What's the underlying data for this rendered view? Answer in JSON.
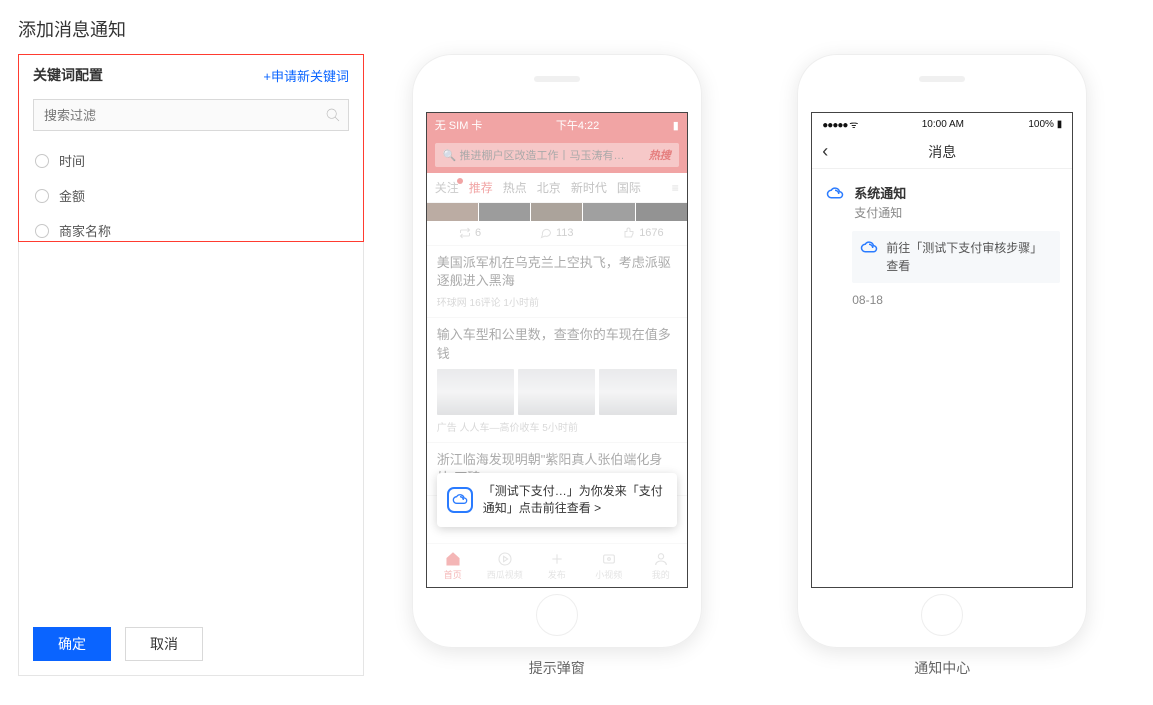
{
  "page": {
    "title": "添加消息通知"
  },
  "config": {
    "title": "关键词配置",
    "apply_link": "+申请新关键词",
    "search_placeholder": "搜索过滤",
    "options": [
      "时间",
      "金额",
      "商家名称"
    ],
    "confirm": "确定",
    "cancel": "取消"
  },
  "phoneA": {
    "caption": "提示弹窗",
    "status_left": "无 SIM 卡",
    "status_center": "下午4:22",
    "search_text": "推进棚户区改造工作丨马玉涛有…",
    "search_hot": "热搜",
    "tabs": {
      "follow": "关注",
      "selected": "推荐",
      "rest": [
        "热点",
        "北京",
        "新时代",
        "国际"
      ]
    },
    "stats": {
      "repost": "6",
      "comment": "113",
      "like": "1676"
    },
    "news1": {
      "title": "美国派军机在乌克兰上空执飞，考虑派驱逐舰进入黑海",
      "meta": "环球网 16评论 1小时前"
    },
    "news2": {
      "title": "输入车型和公里数，查查你的车现在值多钱",
      "meta": "广告 人人车—高价收车  5小时前"
    },
    "news3": {
      "title": "浙江临海发现明朝\"紫阳真人张伯端化身处\"石碑"
    },
    "popup": "「测试下支付…」为你发来「支付通知」点击前往查看 >",
    "tabbar": [
      "首页",
      "西瓜视频",
      "发布",
      "小视频",
      "我的"
    ]
  },
  "phoneB": {
    "caption": "通知中心",
    "status_time": "10:00 AM",
    "status_batt": "100%",
    "nav_title": "消息",
    "msg": {
      "name": "系统通知",
      "sub": "支付通知",
      "body": "前往「测试下支付审核步骤」查看",
      "date": "08-18"
    }
  }
}
